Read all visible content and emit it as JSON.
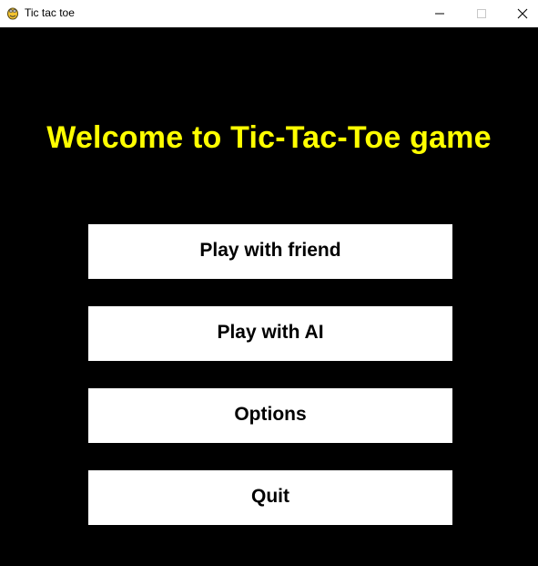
{
  "window": {
    "title": "Tic tac toe",
    "app_icon": "pygame-snake-icon"
  },
  "controls": {
    "minimize_icon": "minimize-icon",
    "maximize_icon": "maximize-icon",
    "close_icon": "close-icon"
  },
  "game": {
    "welcome_text": "Welcome to Tic-Tac-Toe game",
    "buttons": [
      {
        "label": "Play with friend"
      },
      {
        "label": "Play with AI"
      },
      {
        "label": "Options"
      },
      {
        "label": "Quit"
      }
    ]
  },
  "colors": {
    "background": "#000000",
    "title_text": "#ffff00",
    "button_bg": "#ffffff",
    "button_text": "#000000"
  }
}
